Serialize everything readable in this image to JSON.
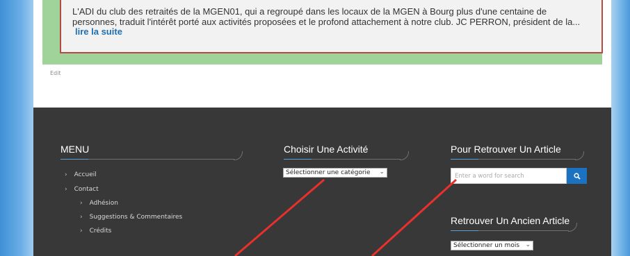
{
  "article": {
    "text": "L'ADI du club des retraités de la MGEN01, qui a regroupé dans les locaux de la MGEN à Bourg plus d'une centaine de personnes, traduit l'intérêt porté aux activités proposées et le profond attachement à notre club. JC PERRON, président de la...",
    "read_more": "lire la suite"
  },
  "edit_label": "Edit",
  "footer": {
    "menu": {
      "title": "MENU",
      "items": [
        {
          "label": "Accueil",
          "level": 1
        },
        {
          "label": "Contact",
          "level": 1
        },
        {
          "label": "Adhésion",
          "level": 2
        },
        {
          "label": "Suggestions & Commentaires",
          "level": 2
        },
        {
          "label": "Crédits",
          "level": 2
        }
      ]
    },
    "activity": {
      "title": "Choisir Une Activité",
      "select_value": "Sélectionner une catégorie"
    },
    "search": {
      "title": "Pour Retrouver Un Article",
      "placeholder": "Enter a word for search",
      "button_icon": "search-icon"
    },
    "archive": {
      "title": "Retrouver Un Ancien Article",
      "select_value": "Sélectionner un mois"
    }
  },
  "colors": {
    "footer_bg": "#383838",
    "accent_blue": "#1b72c0",
    "green_band": "#9fd39a",
    "annotation_red": "#e8302c"
  }
}
